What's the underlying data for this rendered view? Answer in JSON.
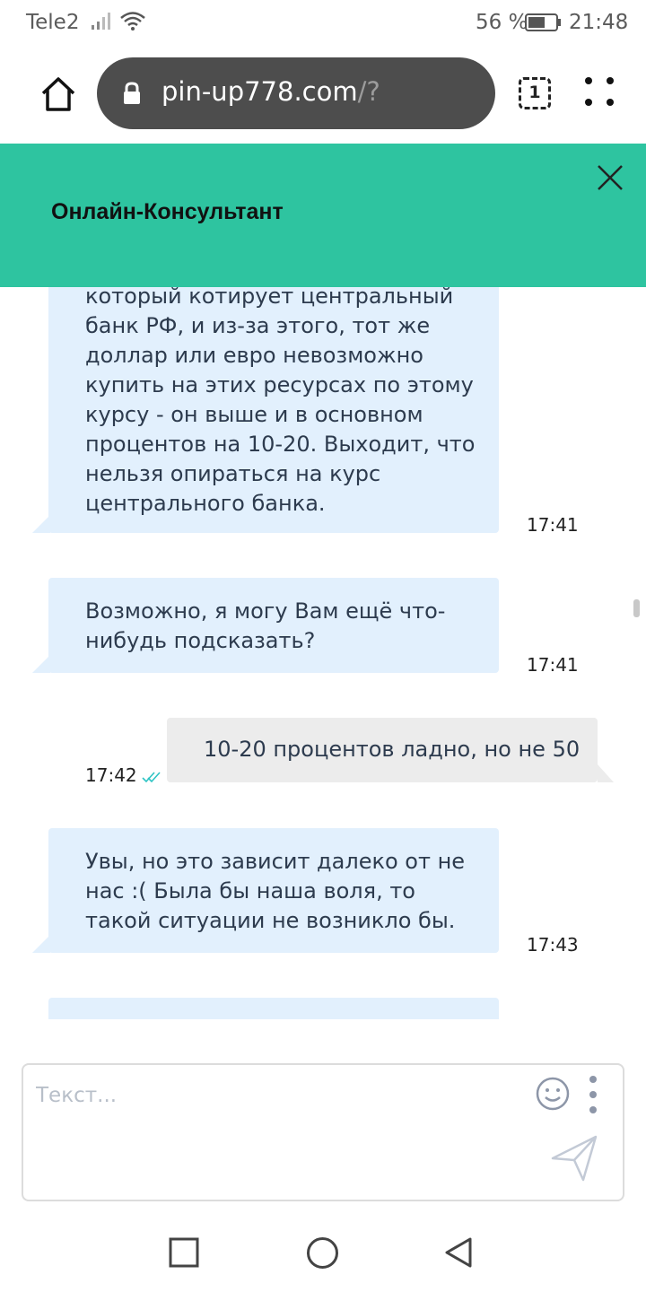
{
  "status_bar": {
    "carrier": "Tele2",
    "battery_percent": "56 %",
    "time": "21:48"
  },
  "browser": {
    "url_domain": "pin-up778.com",
    "url_path": "/?",
    "tab_count": "1"
  },
  "chat": {
    "title": "Онлайн-Консультант",
    "messages": [
      {
        "direction": "incoming",
        "lines": [
          "который котирует центральный",
          "банк РФ, и из-за этого, тот же",
          "доллар или евро невозможно",
          "купить на этих ресурсах по этому",
          "курсу - он выше и в основном",
          "процентов на 10-20. Выходит, что",
          "нельзя опираться на курс",
          "центрального банка."
        ],
        "time": "17:41"
      },
      {
        "direction": "incoming",
        "lines": [
          "Возможно, я могу Вам ещё что-",
          "нибудь подсказать?"
        ],
        "time": "17:41"
      },
      {
        "direction": "outgoing",
        "lines": [
          "10-20 процентов ладно, но не 50"
        ],
        "time": "17:42",
        "read": true
      },
      {
        "direction": "incoming",
        "lines": [
          "Увы, но это зависит далеко от не",
          "нас :( Была бы наша воля, то",
          "такой ситуации не возникло бы."
        ],
        "time": "17:43"
      }
    ]
  },
  "composer": {
    "placeholder": "Текст..."
  },
  "colors": {
    "header": "#2ec4a0",
    "incoming_bubble": "#e2f0fd",
    "outgoing_bubble": "#ececec",
    "read_check": "#2ec4c4",
    "url_bar": "#4d4d4d"
  }
}
